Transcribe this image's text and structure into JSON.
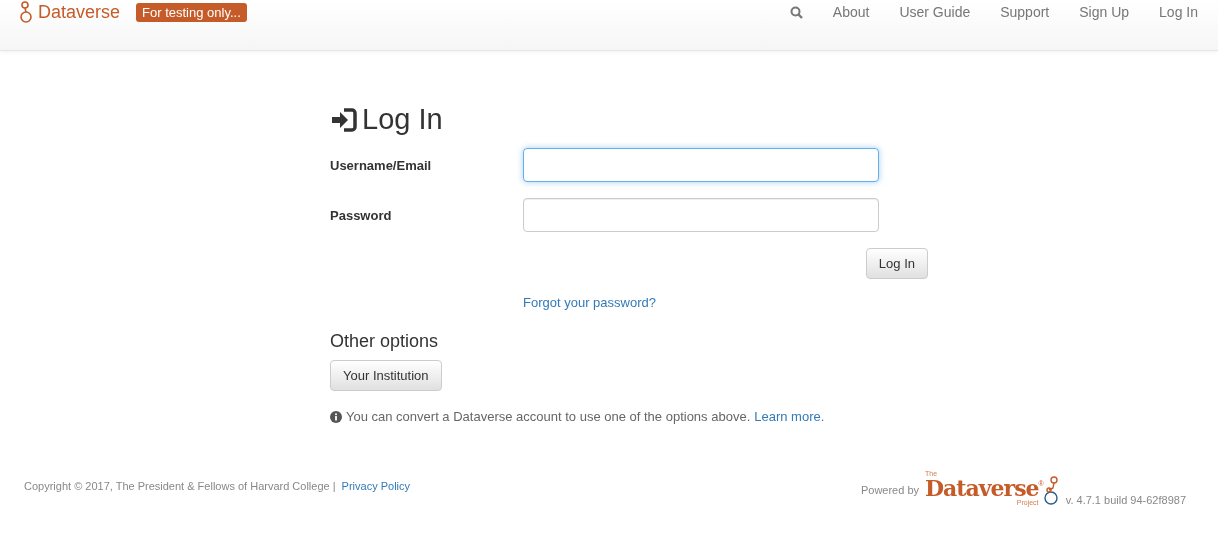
{
  "navbar": {
    "brand": "Dataverse",
    "badge": "For testing only...",
    "links": [
      "About",
      "User Guide",
      "Support",
      "Sign Up",
      "Log In"
    ]
  },
  "login": {
    "title": "Log In",
    "fields": [
      {
        "label": "Username/Email",
        "focused": true
      },
      {
        "label": "Password",
        "focused": false
      }
    ],
    "submit": "Log In",
    "forgot": "Forgot your password?"
  },
  "other_options": {
    "title": "Other options",
    "buttons": [
      "Your Institution"
    ],
    "note": "You can convert a Dataverse account to use one of the options above.",
    "note_link": "Learn more."
  },
  "footer": {
    "copyright": "Copyright © 2017, The President & Fellows of Harvard College |",
    "privacy": "Privacy Policy",
    "powered_by": "Powered by",
    "logo_top": "The",
    "logo_name": "Dataverse",
    "logo_mark": "®",
    "logo_bottom": "Project",
    "version": "v. 4.7.1 build 94-62f8987"
  }
}
